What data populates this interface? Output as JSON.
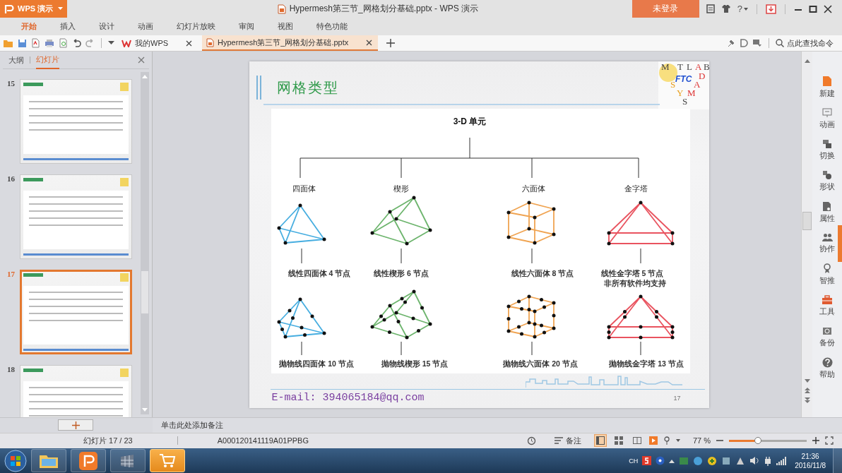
{
  "title_bar": {
    "app_button": "WPS 演示",
    "title": "Hypermesh第三节_网格划分基础.pptx - WPS 演示",
    "login": "未登录",
    "help": "?"
  },
  "menu": [
    {
      "label": "开始",
      "selected": true
    },
    {
      "label": "插入",
      "selected": false
    },
    {
      "label": "设计",
      "selected": false
    },
    {
      "label": "动画",
      "selected": false
    },
    {
      "label": "幻灯片放映",
      "selected": false
    },
    {
      "label": "审阅",
      "selected": false
    },
    {
      "label": "视图",
      "selected": false
    },
    {
      "label": "特色功能",
      "selected": false
    }
  ],
  "doc_tabs": [
    {
      "label": "我的WPS",
      "selected": false
    },
    {
      "label": "Hypermesh第三节_网格划分基础.pptx",
      "selected": true
    }
  ],
  "search": {
    "placeholder": "点此查找命令"
  },
  "left_panel": {
    "tabs": [
      {
        "label": "大纲",
        "selected": false
      },
      {
        "label": "幻灯片",
        "selected": true
      }
    ],
    "slides": [
      {
        "number": "15",
        "selected": false
      },
      {
        "number": "16",
        "selected": false
      },
      {
        "number": "17",
        "selected": true
      },
      {
        "number": "18",
        "selected": false
      }
    ]
  },
  "slide": {
    "title": "网格类型",
    "logo": {
      "letters": [
        "M",
        "T",
        "L",
        "A",
        "B",
        "D",
        "S",
        "A",
        "Y",
        "M",
        "S"
      ],
      "center": "FTC"
    },
    "figure": {
      "title": "3-D 单元",
      "elements": [
        {
          "category": "四面体",
          "kind": "tetrahedron",
          "color": "#45ade0",
          "linear": "线性四面体 4 节点",
          "quadratic": "抛物线四面体 10 节点"
        },
        {
          "category": "楔形",
          "kind": "wedge",
          "color": "#6cb46c",
          "linear": "线性楔形 6 节点",
          "quadratic": "抛物线楔形 15 节点"
        },
        {
          "category": "六面体",
          "kind": "hexahedron",
          "color": "#f0a452",
          "linear": "线性六面体 8 节点",
          "quadratic": "抛物线六面体 20 节点"
        },
        {
          "category": "金字塔",
          "kind": "pyramid",
          "color": "#e9535f",
          "linear": "线性金字塔 5 节点",
          "note": "非所有软件均支持",
          "quadratic": "抛物线金字塔 13 节点"
        }
      ]
    },
    "email": "E-mail: 394065184@qq.com",
    "page": "17"
  },
  "sidebar": [
    {
      "label": "新建",
      "kind": "new"
    },
    {
      "label": "动画",
      "kind": "animation"
    },
    {
      "label": "切换",
      "kind": "transition"
    },
    {
      "label": "形状",
      "kind": "shape"
    },
    {
      "label": "属性",
      "kind": "property"
    },
    {
      "label": "协作",
      "kind": "collab"
    },
    {
      "label": "智推",
      "kind": "smart"
    },
    {
      "label": "工具",
      "kind": "tools"
    },
    {
      "label": "备份",
      "kind": "backup"
    },
    {
      "label": "帮助",
      "kind": "help"
    }
  ],
  "notes": {
    "placeholder": "单击此处添加备注"
  },
  "status_bar": {
    "slide_count": "幻灯片 17 / 23",
    "template": "A000120141119A01PPBG",
    "notes": "备注",
    "views": [
      {
        "kind": "normal",
        "selected": true
      },
      {
        "kind": "sorter",
        "selected": false
      },
      {
        "kind": "reading",
        "selected": false
      }
    ],
    "zoom": "77 %",
    "zoom_slider": {
      "level": 0.37
    }
  },
  "taskbar": {
    "apps": [
      {
        "kind": "explorer",
        "selected": false
      },
      {
        "kind": "presentation",
        "selected": false
      },
      {
        "kind": "grid",
        "selected": false
      },
      {
        "kind": "shop",
        "selected": true
      }
    ],
    "lang": "CH",
    "time": "21:36",
    "date": "2016/11/8"
  }
}
